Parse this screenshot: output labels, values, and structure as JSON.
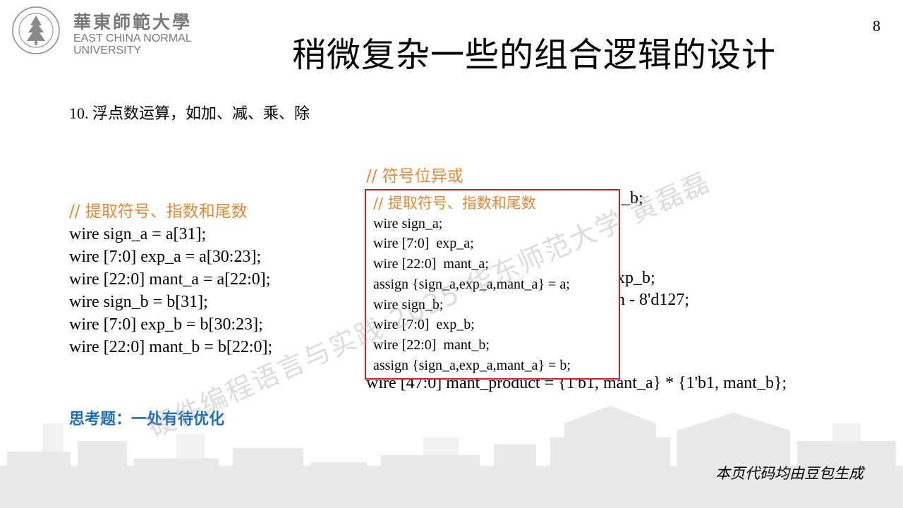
{
  "logo": {
    "cn_name": "華東師範大學",
    "en_line1": "EAST CHINA NORMAL",
    "en_line2": "UNIVERSITY",
    "seal_text": "EAST CHINA NORMAL UNIVERSITY"
  },
  "page_number": "8",
  "title": "稍微复杂一些的组合逻辑的设计",
  "subtitle": "10. 浮点数运算，如加、减、乘、除",
  "left_code": {
    "comment": "// 提取符号、指数和尾数",
    "lines": [
      "wire sign_a = a[31];",
      "wire [7:0] exp_a = a[30:23];",
      "wire [22:0] mant_a = a[22:0];",
      "wire sign_b = b[31];",
      "wire [7:0] exp_b = b[30:23];",
      "wire [22:0] mant_b = b[22:0];"
    ]
  },
  "right_code": {
    "comment": "// 符号位异或",
    "partial_1": "_b;",
    "partial_2": "xp_b;",
    "partial_3": "n - 8'd127;",
    "last_line": "wire [47:0] mant_product = {1'b1, mant_a} * {1'b1, mant_b};"
  },
  "popup": {
    "comment": "// 提取符号、指数和尾数",
    "lines": [
      "wire sign_a;",
      "wire [7:0]  exp_a;",
      "wire [22:0]  mant_a;",
      "assign {sign_a,exp_a,mant_a} = a;",
      "wire sign_b;",
      "wire [7:0]  exp_b;",
      "wire [22:0]  mant_b;",
      "assign {sign_a,exp_a,mant_a} = b;"
    ]
  },
  "think": "思考题：一处有待优化",
  "watermark": "硬件编程语言与实践 2025 华东师范大学 黄磊磊",
  "footer_note": "本页代码均由豆包生成",
  "colors": {
    "comment": "#e08a3c",
    "think": "#1f6db5",
    "popup_border": "#c5262c",
    "logo": "#7a7a7a"
  }
}
